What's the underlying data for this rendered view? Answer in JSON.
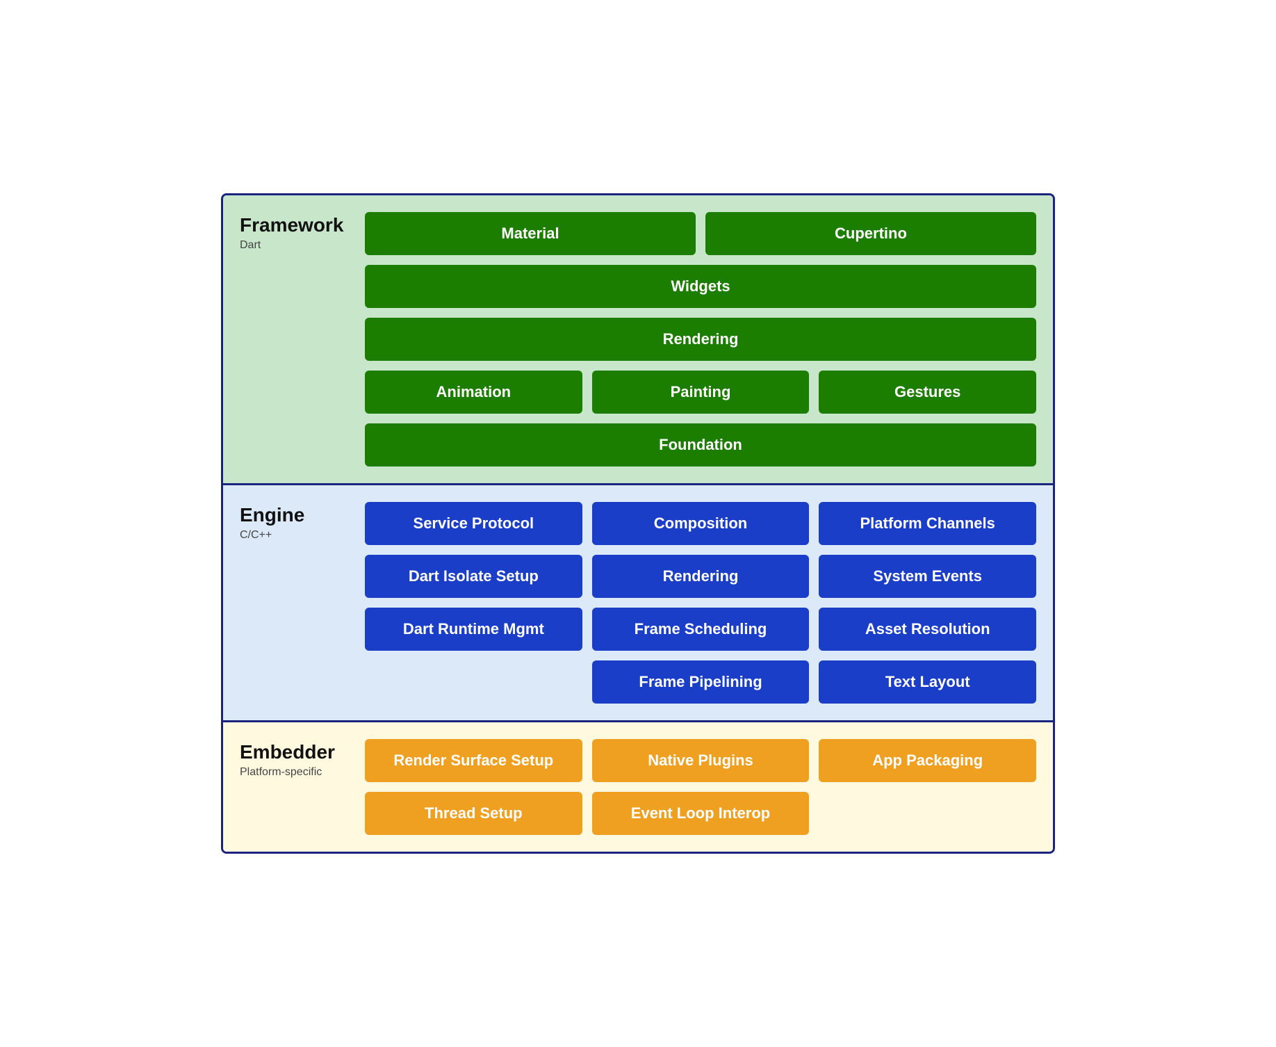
{
  "framework": {
    "title": "Framework",
    "subtitle": "Dart",
    "rows": [
      [
        {
          "label": "Material",
          "span": "half"
        },
        {
          "label": "Cupertino",
          "span": "half"
        }
      ],
      [
        {
          "label": "Widgets",
          "span": "full"
        }
      ],
      [
        {
          "label": "Rendering",
          "span": "full"
        }
      ],
      [
        {
          "label": "Animation",
          "span": "third"
        },
        {
          "label": "Painting",
          "span": "third"
        },
        {
          "label": "Gestures",
          "span": "third"
        }
      ],
      [
        {
          "label": "Foundation",
          "span": "full"
        }
      ]
    ]
  },
  "engine": {
    "title": "Engine",
    "subtitle": "C/C++",
    "col1": [
      {
        "label": "Service Protocol"
      },
      {
        "label": "Dart Isolate Setup"
      },
      {
        "label": "Dart Runtime Mgmt"
      }
    ],
    "col2": [
      {
        "label": "Composition"
      },
      {
        "label": "Rendering"
      },
      {
        "label": "Frame Scheduling"
      },
      {
        "label": "Frame Pipelining"
      }
    ],
    "col3": [
      {
        "label": "Platform Channels"
      },
      {
        "label": "System Events"
      },
      {
        "label": "Asset Resolution"
      },
      {
        "label": "Text Layout"
      }
    ]
  },
  "embedder": {
    "title": "Embedder",
    "subtitle": "Platform-specific",
    "rows": [
      [
        {
          "label": "Render Surface Setup",
          "span": "third"
        },
        {
          "label": "Native Plugins",
          "span": "third"
        },
        {
          "label": "App Packaging",
          "span": "third"
        }
      ],
      [
        {
          "label": "Thread Setup",
          "span": "third"
        },
        {
          "label": "Event Loop Interop",
          "span": "third"
        }
      ]
    ]
  }
}
